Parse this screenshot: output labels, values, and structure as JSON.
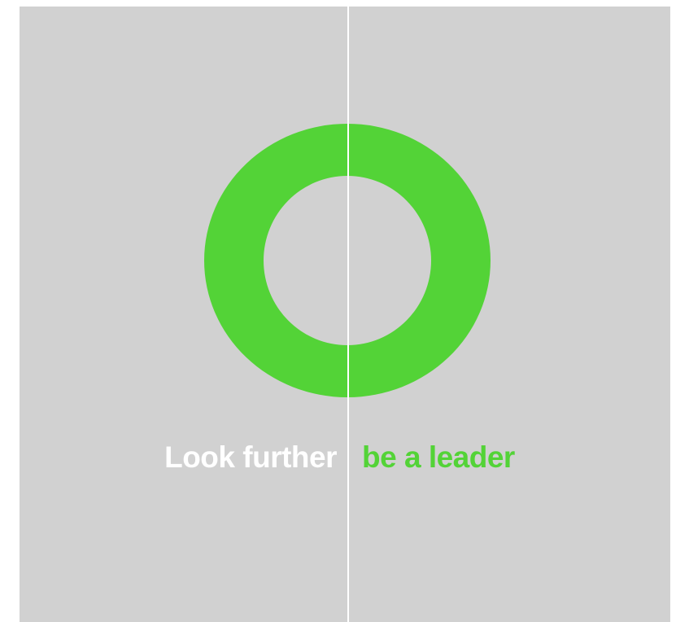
{
  "colors": {
    "background": "#d1d1d1",
    "accent": "#53d337",
    "divider": "#ffffff",
    "text_left": "#ffffff",
    "text_right": "#53d337"
  },
  "logo": {
    "icon": "ring-icon"
  },
  "tagline": {
    "left": "Look further",
    "right": "be a leader"
  }
}
